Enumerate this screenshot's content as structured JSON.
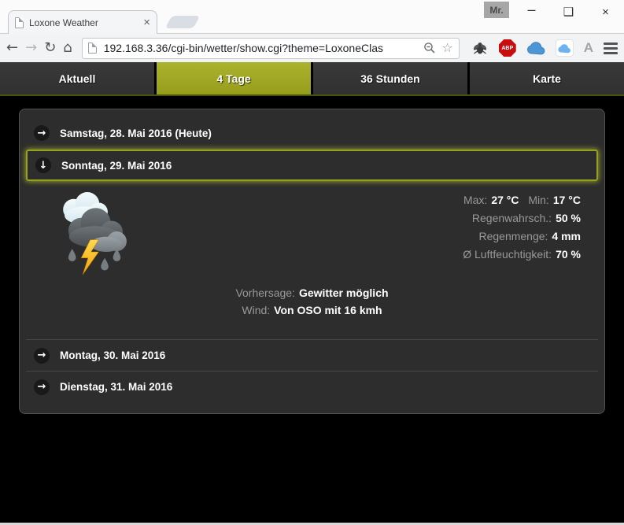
{
  "browser": {
    "tab": {
      "title": "Loxone Weather",
      "close_icon": "×"
    },
    "profile_badge": "Mr.",
    "window_controls": {
      "minimize": "–",
      "maximize": "❑",
      "close": "×"
    },
    "nav": {
      "back": "←",
      "forward": "→",
      "reload": "↻",
      "home": "⌂"
    },
    "omnibox": {
      "url": "192.168.3.36/cgi-bin/wetter/show.cgi?theme=LoxoneClas",
      "bookmark_icon": "☆"
    },
    "extensions": {
      "abp_label": "ABP",
      "letter_a": "A"
    }
  },
  "weather_app": {
    "tabs": [
      {
        "label": "Aktuell",
        "active": false
      },
      {
        "label": "4 Tage",
        "active": true
      },
      {
        "label": "36 Stunden",
        "active": false
      },
      {
        "label": "Karte",
        "active": false
      }
    ],
    "days": [
      {
        "label": "Samstag, 28. Mai 2016 (Heute)",
        "icon": "→",
        "expanded": false
      },
      {
        "label": "Sonntag, 29. Mai 2016",
        "icon": "↓",
        "expanded": true
      },
      {
        "label": "Montag, 30. Mai 2016",
        "icon": "→",
        "expanded": false
      },
      {
        "label": "Dienstag, 31. Mai 2016",
        "icon": "→",
        "expanded": false
      }
    ],
    "forecast": {
      "max_label": "Max:",
      "max_value": "27 °C",
      "min_label": "Min:",
      "min_value": "17 °C",
      "rain_prob_label": "Regenwahrsch.:",
      "rain_prob_value": "50 %",
      "rain_amount_label": "Regenmenge:",
      "rain_amount_value": "4 mm",
      "humidity_label": "Ø Luftfeuchtigkeit:",
      "humidity_value": "70 %",
      "forecast_label": "Vorhersage:",
      "forecast_value": "Gewitter möglich",
      "wind_label": "Wind:",
      "wind_value": "Von OSO mit 16 kmh"
    },
    "colors": {
      "accent": "#9ea71f",
      "tab_inactive": "#343434",
      "panel_bg": "#2d2d2d",
      "page_bg": "#000000"
    }
  }
}
